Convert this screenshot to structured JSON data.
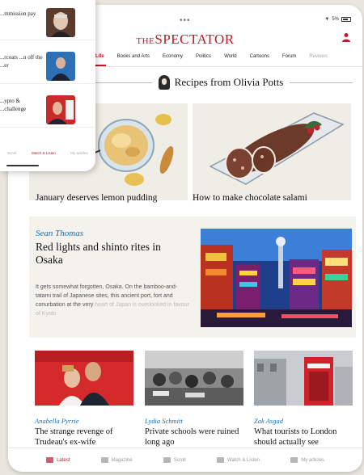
{
  "status": {
    "signal": "▼",
    "battery": "5%"
  },
  "header": {
    "logo": "SPECTATOR",
    "logo_prefix": "THE"
  },
  "nav": {
    "items": [
      {
        "label": "Life",
        "active": true
      },
      {
        "label": "Books and Arts"
      },
      {
        "label": "Economy"
      },
      {
        "label": "Politics"
      },
      {
        "label": "World"
      },
      {
        "label": "Cartoons"
      },
      {
        "label": "Forum"
      },
      {
        "label": "Reviews",
        "faded": true
      }
    ]
  },
  "recipes": {
    "section_title": "Recipes from Olivia Potts",
    "cards": [
      {
        "title": "January deserves lemon pudding"
      },
      {
        "title": "How to make chocolate salami"
      }
    ]
  },
  "featured": {
    "author": "Sean Thomas",
    "headline": "Red lights and shinto rites in Osaka",
    "excerpt": "It gets somewhat forgotten, Osaka. On the bamboo-and-tatami trail of Japanese sites, this ancient port, fort and conurbation at the very",
    "excerpt_fade": "heart of Japan is overlooked in favour of Kyoto"
  },
  "stories": [
    {
      "author": "Anabella Pyrrie",
      "headline": "The strange revenge of Trudeau's ex-wife"
    },
    {
      "author": "Lydia Schmitt",
      "headline": "Private schools were ruined long ago"
    },
    {
      "author": "Zak Asgad",
      "headline": "What tourists to London should actually see"
    }
  ],
  "tabbar": [
    {
      "label": "Latest",
      "active": true
    },
    {
      "label": "Magazine"
    },
    {
      "label": "Scroll"
    },
    {
      "label": "Watch & Listen"
    },
    {
      "label": "My articles"
    }
  ],
  "panel": {
    "rows": [
      {
        "text": "...mmission pay",
        "meta": ""
      },
      {
        "text": "...rcoats ...n off the ...er",
        "meta": ""
      },
      {
        "text": "...ypto & ...challenge",
        "meta": ""
      }
    ],
    "tabs": [
      {
        "label": "Scroll"
      },
      {
        "label": "Watch & Listen",
        "active": true
      },
      {
        "label": "My articles"
      }
    ]
  },
  "colors": {
    "brand": "#c2172c",
    "author": "#1b6ea8"
  }
}
